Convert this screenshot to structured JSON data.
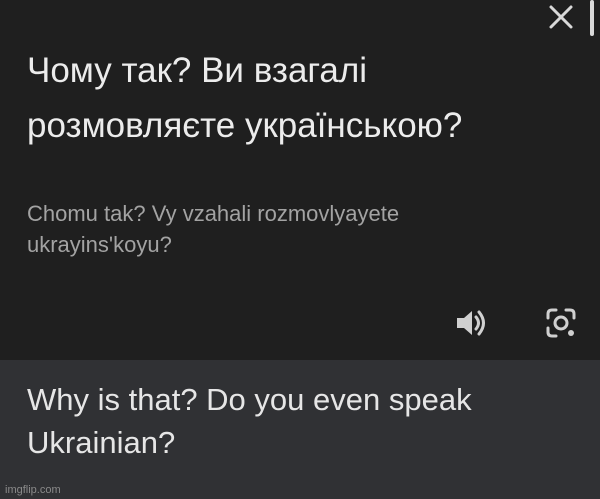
{
  "source": {
    "text": "Чому так? Ви взагалі розмовляєте українською?",
    "transliteration": "Chomu tak? Vy vzahali rozmovlyayete ukrayinsʹkoyu?"
  },
  "target": {
    "text": "Why is that? Do you even speak Ukrainian?"
  },
  "watermark": "imgflip.com",
  "icons": {
    "close": "close-icon",
    "speaker": "speaker-icon",
    "lens": "camera-lens-icon"
  },
  "colors": {
    "source_bg": "#1f1f1f",
    "target_bg": "#303134",
    "text_primary": "#ececec",
    "text_secondary": "#a3a3a3"
  }
}
